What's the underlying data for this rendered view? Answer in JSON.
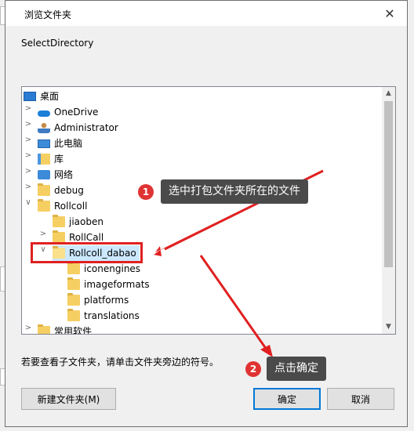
{
  "dialog": {
    "title": "浏览文件夹",
    "close_glyph": "✕",
    "description": "SelectDirectory"
  },
  "tree": {
    "items": [
      {
        "label": "桌面",
        "icon": "desktop-icon"
      },
      {
        "label": "OneDrive",
        "icon": "onedrive-icon"
      },
      {
        "label": "Administrator",
        "icon": "user-icon"
      },
      {
        "label": "此电脑",
        "icon": "computer-icon"
      },
      {
        "label": "库",
        "icon": "library-icon"
      },
      {
        "label": "网络",
        "icon": "network-icon"
      },
      {
        "label": "debug",
        "icon": "folder-icon"
      },
      {
        "label": "Rollcoll",
        "icon": "folder-icon"
      },
      {
        "label": "jiaoben",
        "icon": "folder-icon"
      },
      {
        "label": "RollCall",
        "icon": "folder-icon"
      },
      {
        "label": "Rollcoll_dabao",
        "icon": "folder-open-icon",
        "selected": true
      },
      {
        "label": "iconengines",
        "icon": "folder-icon"
      },
      {
        "label": "imageformats",
        "icon": "folder-icon"
      },
      {
        "label": "platforms",
        "icon": "folder-icon"
      },
      {
        "label": "translations",
        "icon": "folder-icon"
      },
      {
        "label": "常用软件",
        "icon": "folder-icon"
      }
    ]
  },
  "hint": "若要查看子文件夹，请单击文件夹旁边的符号。",
  "buttons": {
    "new_folder": "新建文件夹(M)",
    "ok": "确定",
    "cancel": "取消"
  },
  "annotations": {
    "step1_number": "1",
    "step1_text": "选中打包文件夹所在的文件",
    "step2_number": "2",
    "step2_text": "点击确定",
    "color": "#e02020"
  }
}
